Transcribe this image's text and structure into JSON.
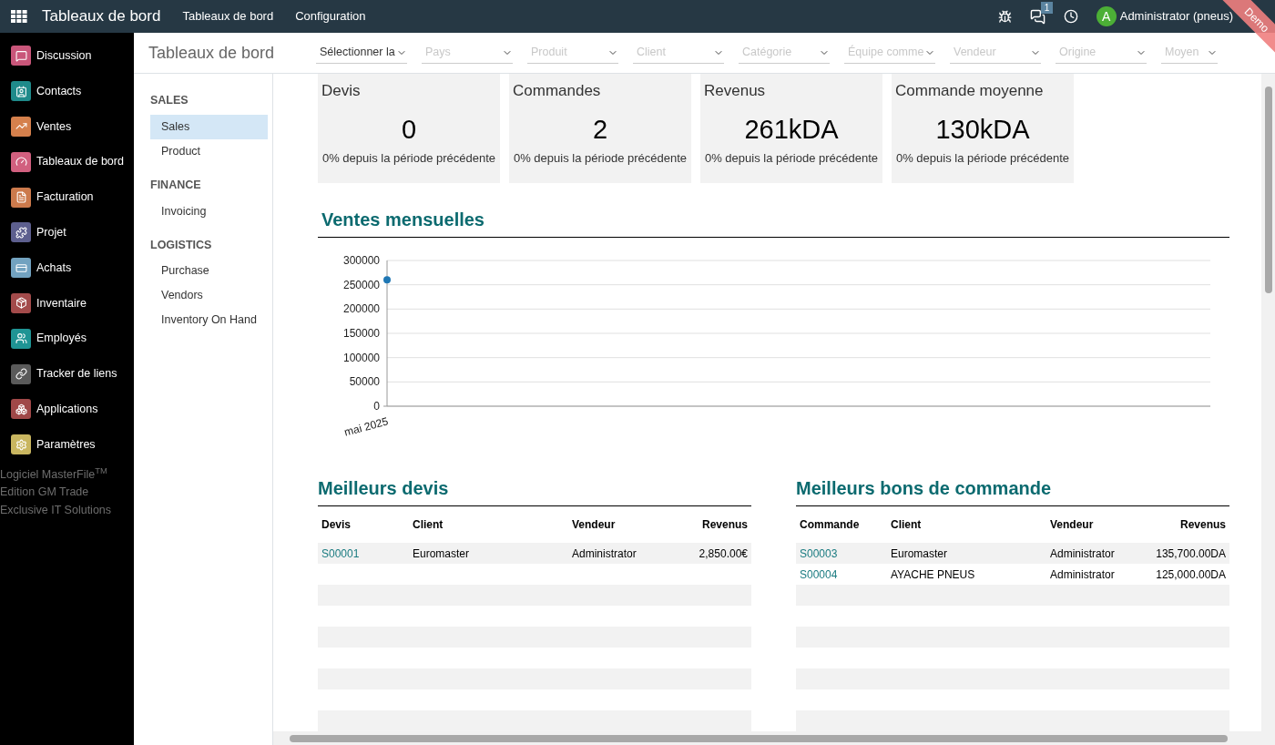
{
  "topbar": {
    "app_title": "Tableaux de bord",
    "menu": [
      "Tableaux de bord",
      "Configuration"
    ],
    "message_count": "1",
    "avatar_letter": "A",
    "user": "Administrator (pneus)",
    "ribbon": "Demo"
  },
  "apps": [
    {
      "label": "Discussion",
      "color": "#c9567a"
    },
    {
      "label": "Contacts",
      "color": "#1f8a8a"
    },
    {
      "label": "Ventes",
      "color": "#d5804c"
    },
    {
      "label": "Tableaux de bord",
      "color": "#d1607f"
    },
    {
      "label": "Facturation",
      "color": "#cc7a4c"
    },
    {
      "label": "Projet",
      "color": "#5d5f8e"
    },
    {
      "label": "Achats",
      "color": "#72a2c0"
    },
    {
      "label": "Inventaire",
      "color": "#a34b4b"
    },
    {
      "label": "Employés",
      "color": "#1f9494"
    },
    {
      "label": "Tracker de liens",
      "color": "#5a5a5a"
    },
    {
      "label": "Applications",
      "color": "#a04848"
    },
    {
      "label": "Paramètres",
      "color": "#c9b660"
    }
  ],
  "footer": [
    "Logiciel MasterFile$^{TM}$",
    "Edition GM Trade",
    "Exclusive IT Solutions"
  ],
  "page_title": "Tableaux de bord",
  "filters": [
    {
      "value": "Sélectionner la"
    },
    {
      "placeholder": "Pays"
    },
    {
      "placeholder": "Produit"
    },
    {
      "placeholder": "Client"
    },
    {
      "placeholder": "Catégorie"
    },
    {
      "placeholder": "Équipe comme"
    },
    {
      "placeholder": "Vendeur"
    },
    {
      "placeholder": "Origine"
    },
    {
      "placeholder": "Moyen"
    }
  ],
  "menu_sections": [
    {
      "title": "SALES",
      "items": [
        {
          "label": "Sales",
          "selected": true
        },
        {
          "label": "Product",
          "selected": false
        }
      ]
    },
    {
      "title": "FINANCE",
      "items": [
        {
          "label": "Invoicing",
          "selected": false
        }
      ]
    },
    {
      "title": "LOGISTICS",
      "items": [
        {
          "label": "Purchase",
          "selected": false
        },
        {
          "label": "Vendors",
          "selected": false
        },
        {
          "label": "Inventory On Hand",
          "selected": false
        }
      ]
    }
  ],
  "kpis": [
    {
      "title": "Devis",
      "value": "0",
      "change": "0% depuis la période précédente"
    },
    {
      "title": "Commandes",
      "value": "2",
      "change": "0% depuis la période précédente"
    },
    {
      "title": "Revenus",
      "value": "261kDA",
      "change": "0% depuis la période précédente"
    },
    {
      "title": "Commande moyenne",
      "value": "130kDA",
      "change": "0% depuis la période précédente"
    }
  ],
  "monthly_sales": {
    "title": "Ventes mensuelles",
    "chart_data": {
      "type": "line",
      "categories": [
        "mai 2025"
      ],
      "grid": true,
      "series": [
        {
          "color": "#1f77b4",
          "marker": true,
          "values": [
            260000
          ]
        }
      ],
      "ylim": [
        0,
        300000
      ],
      "yticks": [
        0,
        50000,
        100000,
        150000,
        200000,
        250000,
        300000
      ]
    }
  },
  "tables": [
    {
      "title": "Meilleurs devis",
      "columns": [
        "Devis",
        "Client",
        "Vendeur",
        "Revenus"
      ],
      "rows": [
        [
          "S00001",
          "Euromaster",
          "Administrator",
          "2,850.00€"
        ]
      ]
    },
    {
      "title": "Meilleurs bons de commande",
      "columns": [
        "Commande",
        "Client",
        "Vendeur",
        "Revenus"
      ],
      "rows": [
        [
          "S00003",
          "Euromaster",
          "Administrator",
          "135,700.00DA"
        ],
        [
          "S00004",
          "AYACHE PNEUS",
          "Administrator",
          "125,000.00DA"
        ]
      ]
    }
  ]
}
